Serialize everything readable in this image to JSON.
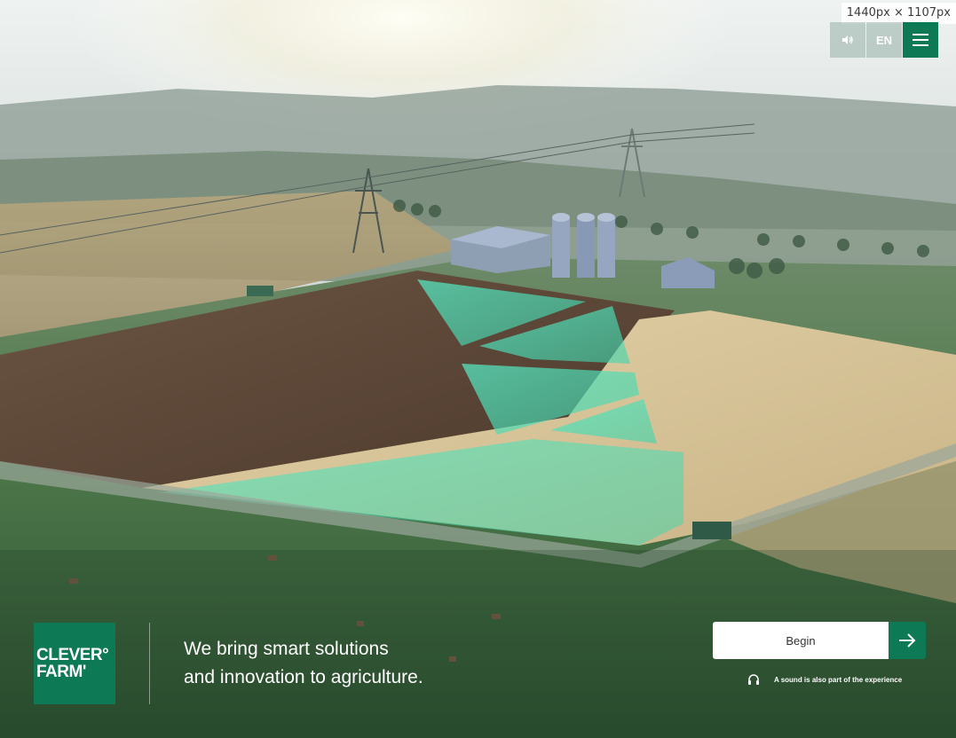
{
  "viewport_badge": "1440px × 1107px",
  "topbar": {
    "sound_icon": "speaker-icon",
    "language_label": "EN",
    "menu_icon": "hamburger-menu-icon"
  },
  "logo": {
    "line1": "CLEVER°",
    "line2": "FARM'"
  },
  "tagline": {
    "line1": "We bring smart solutions",
    "line2": "and innovation to agriculture."
  },
  "cta": {
    "label": "Begin",
    "arrow_icon": "arrow-right-icon"
  },
  "sound_note": {
    "icon": "headphones-icon",
    "text": "A sound is also part of the experience"
  },
  "colors": {
    "brand_green": "#0d7a55",
    "field_highlight": "#3fe0b4"
  }
}
